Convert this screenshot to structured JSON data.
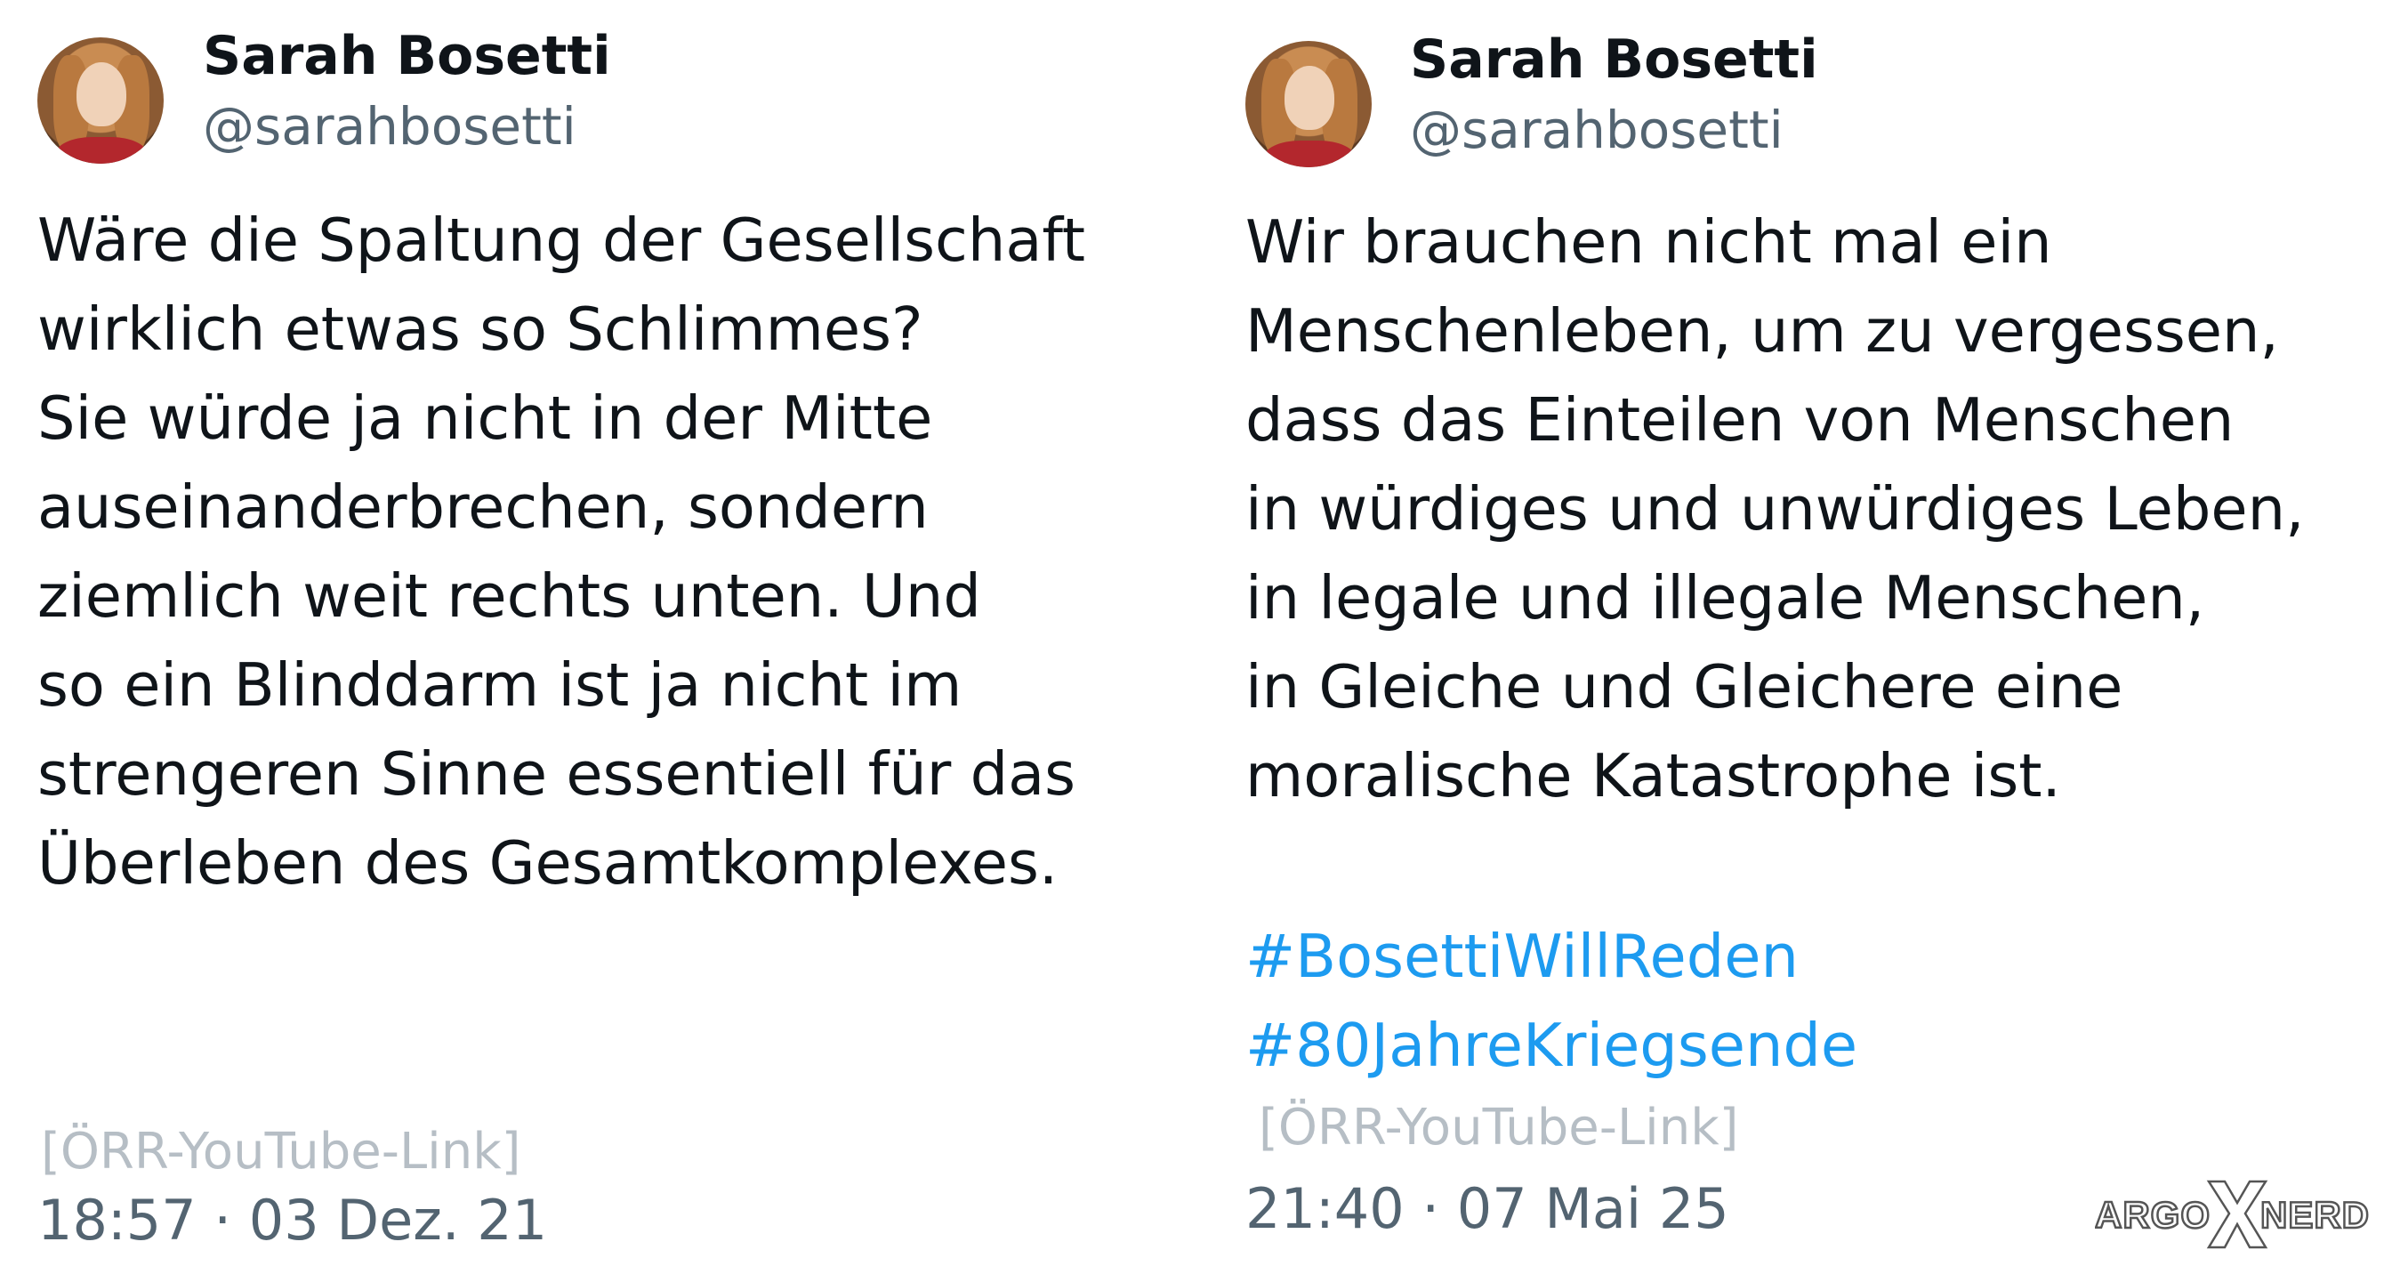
{
  "tweet_left": {
    "name": "Sarah Bosetti",
    "handle": "@sarahbosetti",
    "text_lines": [
      "Wäre die Spaltung der Gesellschaft",
      "wirklich etwas so Schlimmes?",
      "Sie würde ja nicht in der Mitte",
      "auseinanderbrechen, sondern",
      "ziemlich weit rechts unten. Und",
      "so ein Blinddarm ist ja nicht im",
      "strengeren Sinne essentiell für das",
      "Überleben des Gesamtkomplexes."
    ],
    "link_text": "[ÖRR-YouTube-Link]",
    "timestamp": "18:57 · 03 Dez. 21"
  },
  "tweet_right": {
    "name": "Sarah Bosetti",
    "handle": "@sarahbosetti",
    "text_lines": [
      "Wir brauchen nicht mal ein",
      "Menschenleben, um zu vergessen,",
      "dass das Einteilen von Menschen",
      "in würdiges und unwürdiges Leben,",
      "in legale und illegale Menschen,",
      "in Gleiche und Gleichere eine",
      "moralische Katastrophe ist."
    ],
    "hashtags": [
      "#BosettiWillReden",
      "#80JahreKriegsende"
    ],
    "link_text": "[ÖRR-YouTube-Link]",
    "timestamp": "21:40 · 07 Mai 25"
  },
  "watermark": {
    "left": "ARGO",
    "right": "NERD"
  },
  "colors": {
    "text": "#0f1419",
    "secondary": "#536471",
    "hashtag": "#1d9bf0",
    "link": "#b6bec5"
  }
}
